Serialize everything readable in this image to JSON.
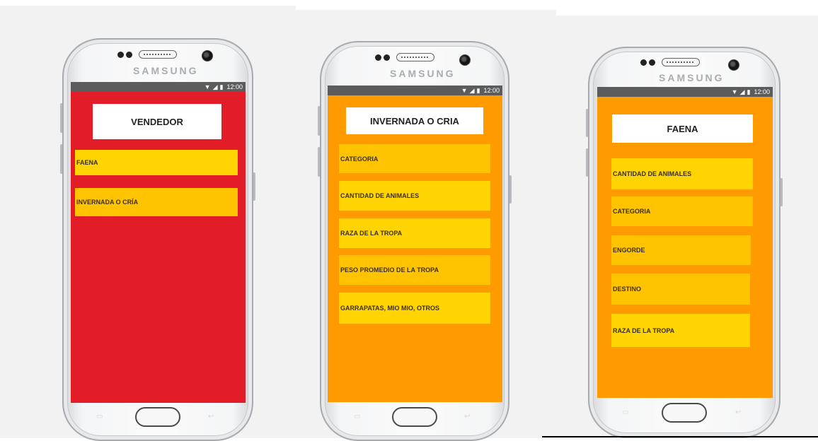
{
  "colors": {
    "screen1_bg": "#e21d27",
    "screen2_bg": "#ff9a00",
    "screen3_bg": "#ff9a00",
    "item_yellow": "#ffd400",
    "item_gold": "#ffc300",
    "statusbar": "#5c5c5c"
  },
  "device": {
    "brand": "SAMSUNG"
  },
  "status_bar": {
    "time": "12:00",
    "wifi_icon": "wifi-icon",
    "signal_icon": "signal-icon",
    "battery_icon": "battery-icon"
  },
  "screens": [
    {
      "title": "VENDEDOR",
      "items": [
        "FAENA",
        "INVERNADA O CRÍA"
      ]
    },
    {
      "title": "INVERNADA O CRIA",
      "items": [
        "CATEGORIA",
        "CANTIDAD DE ANIMALES",
        "RAZA DE LA TROPA",
        "PESO PROMEDIO DE LA TROPA",
        "GARRAPATAS, MIO MIO, OTROS"
      ]
    },
    {
      "title": "FAENA",
      "items": [
        "CANTIDAD DE ANIMALES",
        "CATEGORIA",
        "ENGORDE",
        "DESTINO",
        "RAZA DE LA TROPA"
      ]
    }
  ]
}
